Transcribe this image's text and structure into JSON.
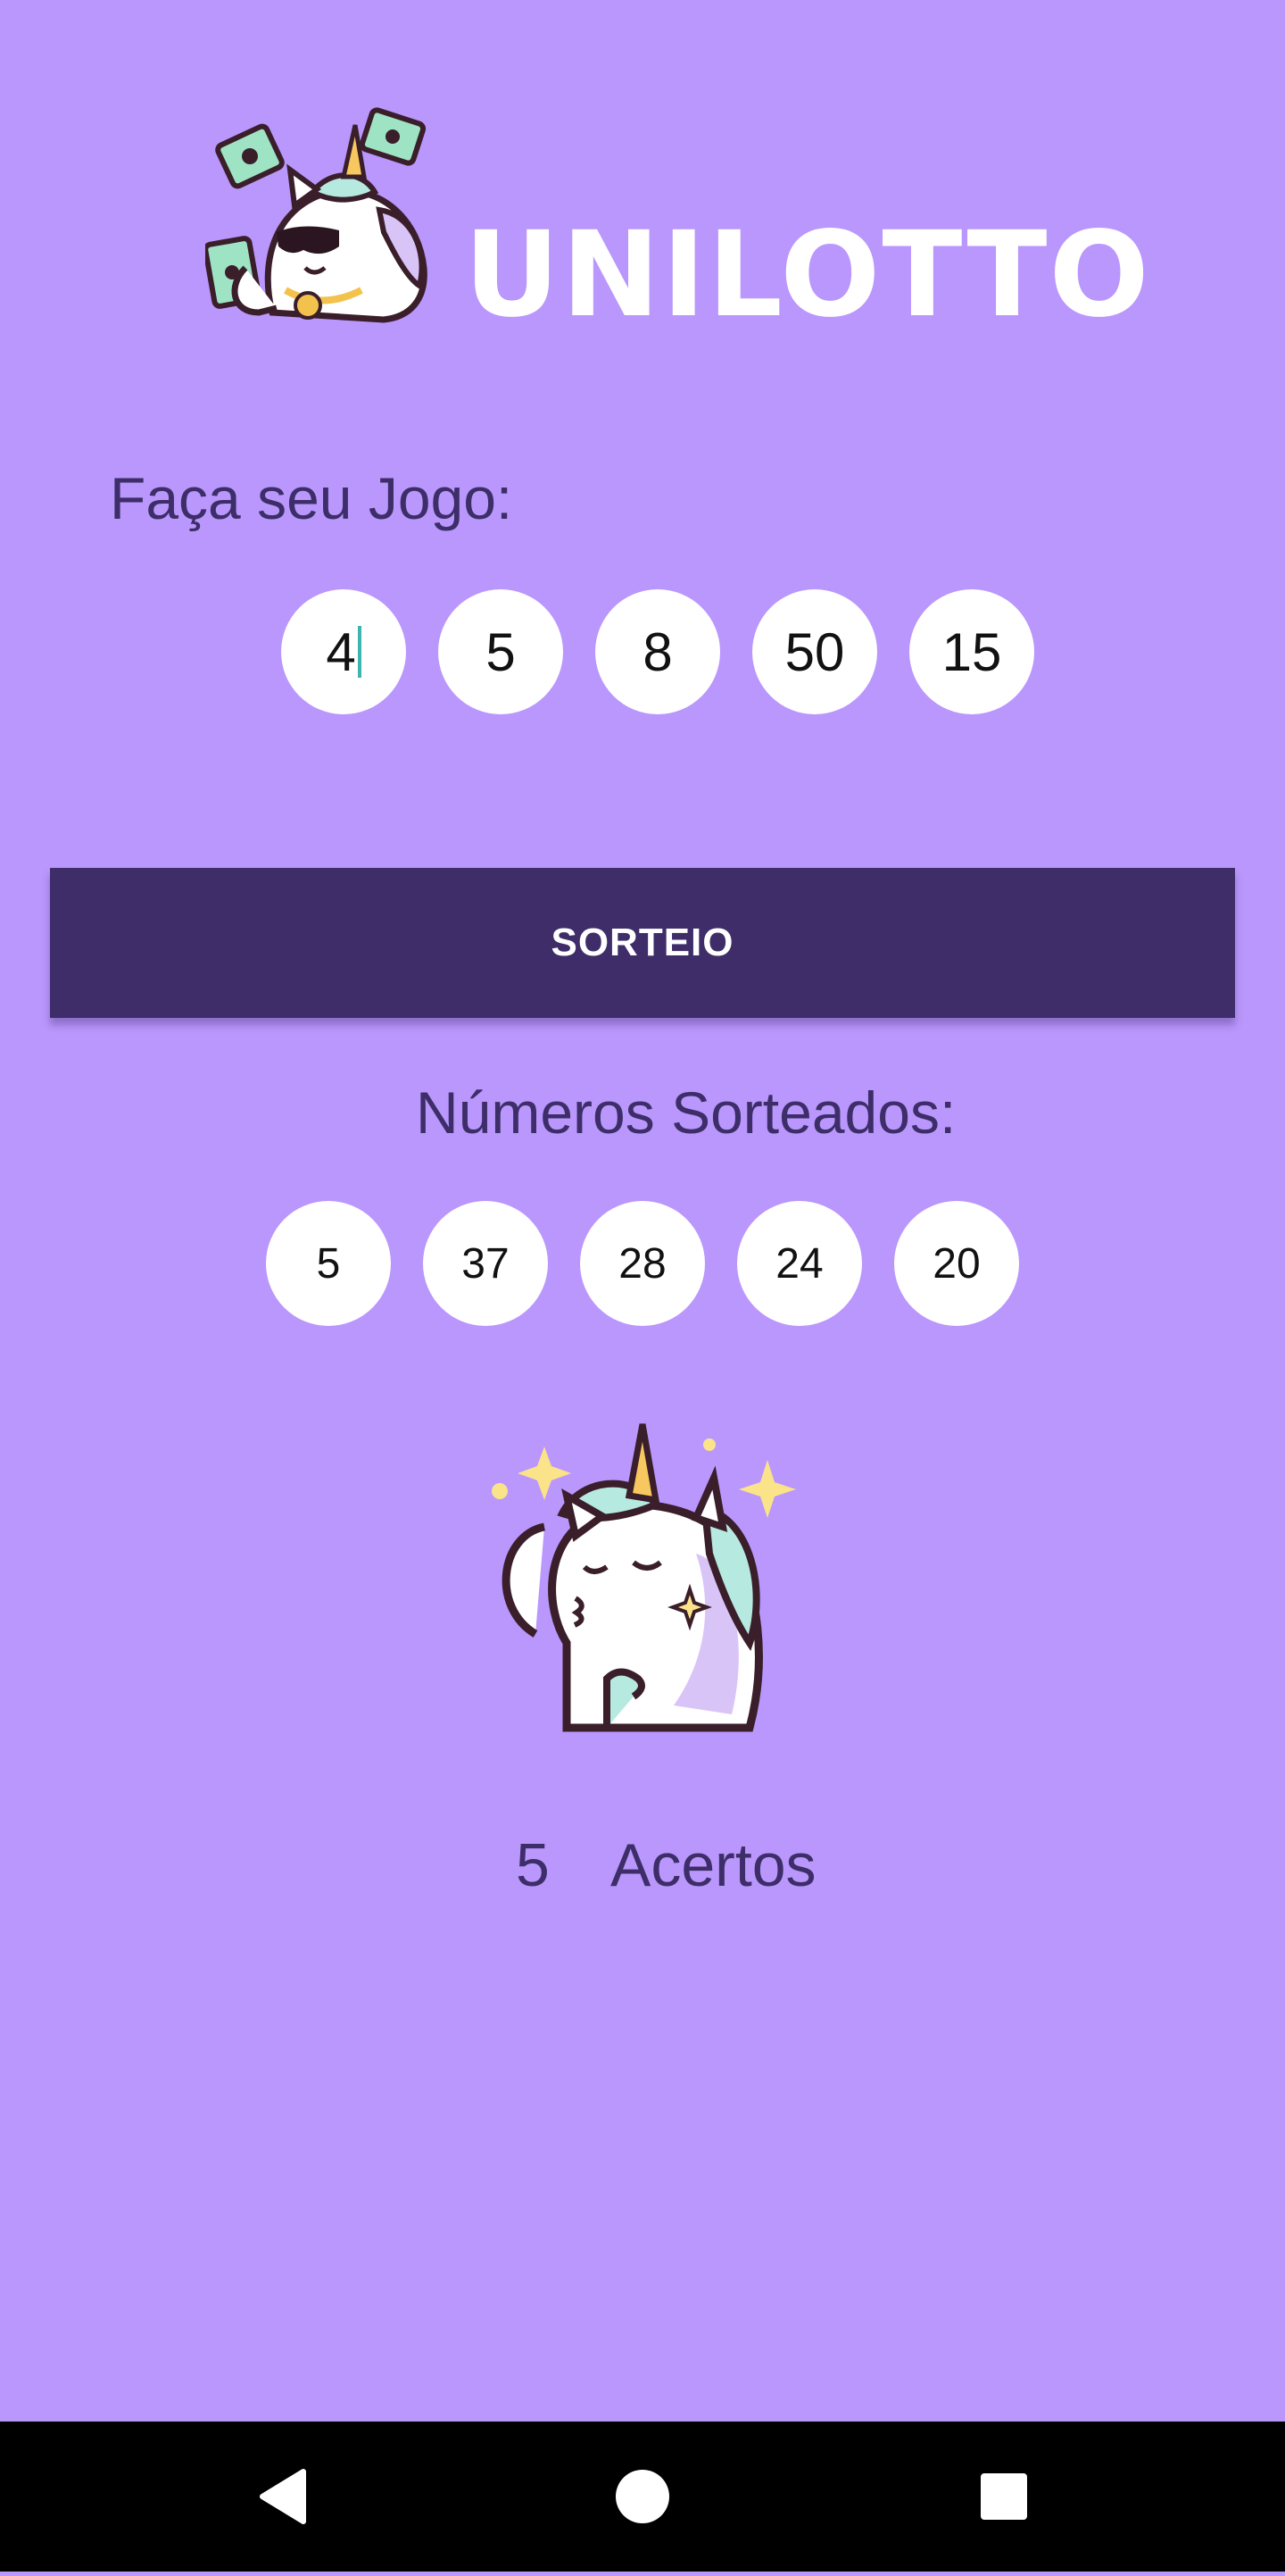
{
  "header": {
    "title": "UNILOTTO",
    "mascot_icon": "money-unicorn-icon"
  },
  "bet": {
    "label": "Faça seu Jogo:",
    "numbers": [
      "4",
      "5",
      "8",
      "50",
      "15"
    ]
  },
  "draw_button": {
    "label": "SORTEIO"
  },
  "results": {
    "label": "Números Sorteados:",
    "numbers": [
      "5",
      "37",
      "28",
      "24",
      "20"
    ]
  },
  "result_mascot_icon": "happy-unicorn-icon",
  "hits": {
    "count": "5",
    "label": "Acertos"
  },
  "navigation": {
    "back_icon": "back-triangle-icon",
    "home_icon": "home-circle-icon",
    "recents_icon": "recents-square-icon"
  },
  "colors": {
    "background": "#b997fc",
    "accent": "#3e2d69",
    "text": "#3d2d68",
    "circle": "#ffffff"
  }
}
